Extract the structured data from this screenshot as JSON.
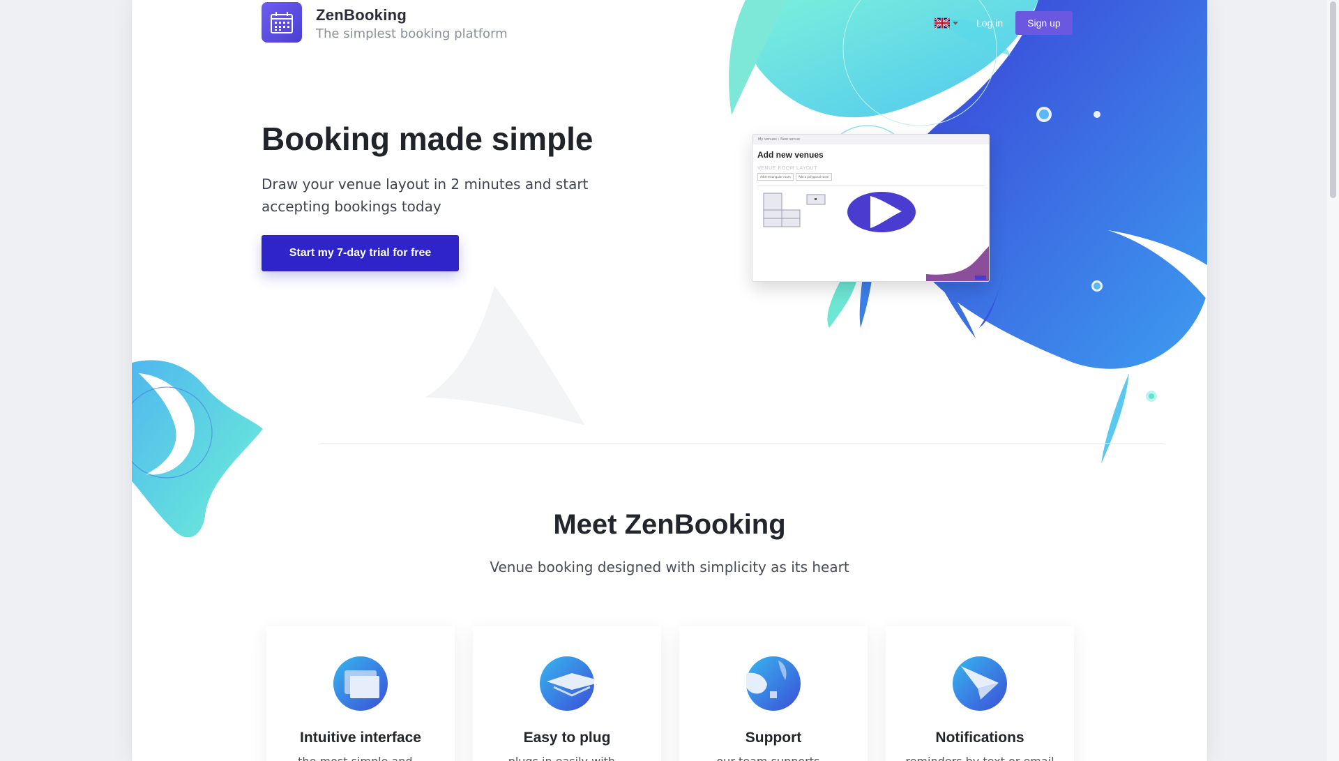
{
  "header": {
    "brand_name": "ZenBooking",
    "brand_tagline": "The simplest booking platform",
    "language_icon": "uk-flag-icon",
    "login_label": "Log in",
    "signup_label": "Sign up"
  },
  "hero": {
    "title": "Booking made simple",
    "subtitle": "Draw your venue layout in 2 minutes and start accepting bookings today",
    "cta_label": "Start my 7-day trial for free"
  },
  "mockup": {
    "breadcrumb": "My venues  ›  New venue",
    "title": "Add new venues",
    "section_label": "VENUE ROOM LAYOUT",
    "buttons": [
      "Add rectangular room",
      "Add a polygonal room"
    ],
    "play_icon": "play-icon"
  },
  "meet": {
    "title": "Meet ZenBooking",
    "subtitle": "Venue booking designed with simplicity as its heart",
    "features": [
      {
        "title": "Intuitive interface",
        "desc": "the most simple and...",
        "icon": "window-icon"
      },
      {
        "title": "Easy to plug",
        "desc": "plugs in easily with...",
        "icon": "layers-icon"
      },
      {
        "title": "Support",
        "desc": "our team supports...",
        "icon": "support-icon"
      },
      {
        "title": "Notifications",
        "desc": "reminders by text or email",
        "icon": "paper-plane-icon"
      }
    ]
  },
  "colors": {
    "accent": "#2f24c9",
    "signup": "#6b58e0",
    "logo": "#6c5ce7",
    "teal": "#5fe3d6",
    "blue": "#3a5ee0"
  }
}
